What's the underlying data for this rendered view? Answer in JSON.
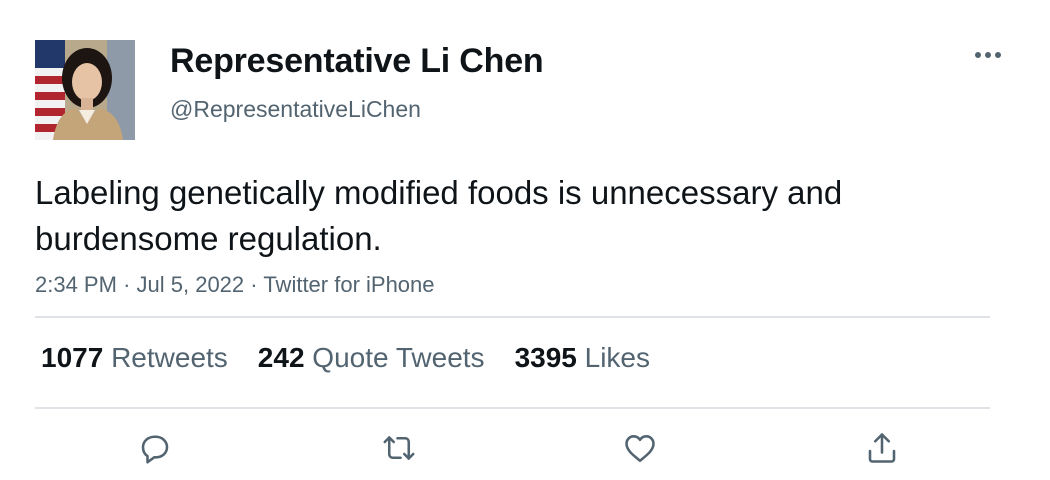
{
  "author": {
    "display_name": "Representative Li Chen",
    "handle": "@RepresentativeLiChen"
  },
  "tweet": {
    "text": "Labeling genetically modified foods is unnecessary and burdensome regulation.",
    "time": "2:34 PM",
    "date": "Jul 5, 2022",
    "source": "Twitter for iPhone",
    "separator": "·"
  },
  "stats": {
    "retweets_count": "1077",
    "retweets_label": "Retweets",
    "quotes_count": "242",
    "quotes_label": "Quote Tweets",
    "likes_count": "3395",
    "likes_label": "Likes"
  },
  "icons": {
    "more": "more-horizontal-icon",
    "reply": "reply-icon",
    "retweet": "retweet-icon",
    "like": "heart-icon",
    "share": "share-icon"
  },
  "colors": {
    "text_primary": "#0f1419",
    "text_secondary": "#536471",
    "divider": "#dfe3e7"
  }
}
